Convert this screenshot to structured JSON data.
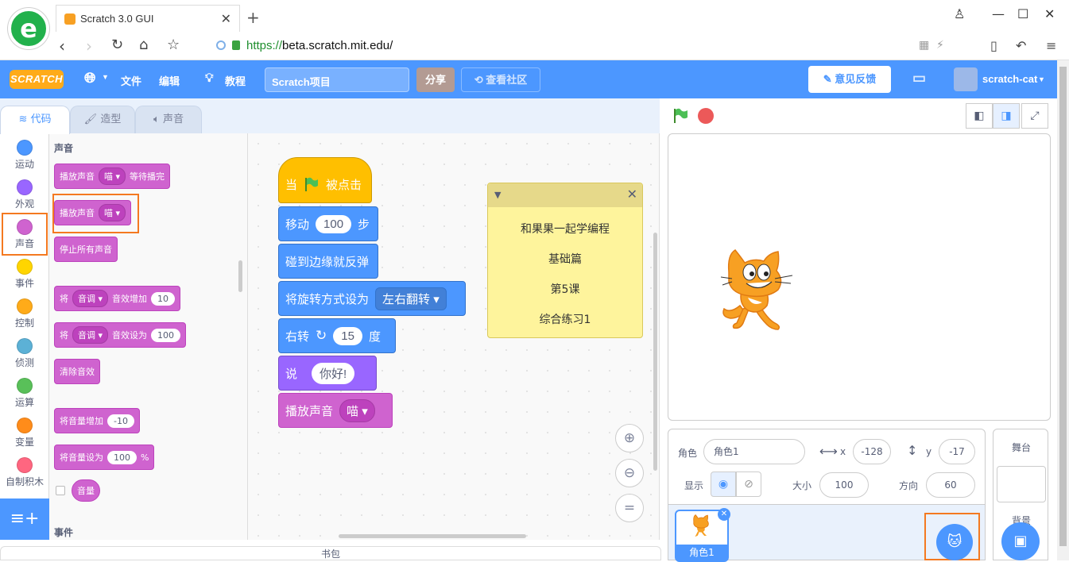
{
  "browser": {
    "tab_title": "Scratch 3.0 GUI",
    "url_scheme": "https://",
    "url_host": "beta.scratch.mit.edu/",
    "logo_letter": "e"
  },
  "menu": {
    "logo": "SCRATCH",
    "file": "文件",
    "edit": "编辑",
    "tutorials": "教程",
    "project_title": "Scratch项目",
    "share": "分享",
    "see_community": "查看社区",
    "feedback": "意见反馈",
    "username": "scratch-cat"
  },
  "editor_tabs": [
    {
      "label": "代码",
      "icon": "code-icon"
    },
    {
      "label": "造型",
      "icon": "brush-icon"
    },
    {
      "label": "声音",
      "icon": "speaker-icon"
    }
  ],
  "categories": [
    {
      "label": "运动",
      "color": "#4c97ff"
    },
    {
      "label": "外观",
      "color": "#9966ff"
    },
    {
      "label": "声音",
      "color": "#cf63cf"
    },
    {
      "label": "事件",
      "color": "#ffd500"
    },
    {
      "label": "控制",
      "color": "#ffab19"
    },
    {
      "label": "侦测",
      "color": "#5cb1d6"
    },
    {
      "label": "运算",
      "color": "#59c059"
    },
    {
      "label": "变量",
      "color": "#ff8c1a"
    },
    {
      "label": "自制积木",
      "color": "#ff6680"
    }
  ],
  "palette": {
    "heading_sound": "声音",
    "heading_events": "事件",
    "blocks": {
      "play_until_done": {
        "text": "播放声音",
        "dd": "喵",
        "suffix": "等待播完"
      },
      "start_sound": {
        "text": "播放声音",
        "dd": "喵"
      },
      "stop_all": {
        "text": "停止所有声音"
      },
      "change_effect": {
        "prefix": "将",
        "dd": "音调",
        "text": "音效增加",
        "value": "10"
      },
      "set_effect": {
        "prefix": "将",
        "dd": "音调",
        "text": "音效设为",
        "value": "100"
      },
      "clear_effects": {
        "text": "清除音效"
      },
      "change_volume": {
        "text": "将音量增加",
        "value": "-10"
      },
      "set_volume": {
        "text": "将音量设为",
        "value": "100",
        "suffix": "%"
      },
      "volume_reporter": {
        "text": "音量"
      }
    }
  },
  "script": {
    "when_flag": {
      "prefix": "当",
      "suffix": "被点击"
    },
    "move": {
      "text": "移动",
      "value": "100",
      "suffix": "步"
    },
    "bounce": {
      "text": "碰到边缘就反弹"
    },
    "rotation_style": {
      "text": "将旋转方式设为",
      "dd": "左右翻转"
    },
    "turn": {
      "text": "右转",
      "value": "15",
      "suffix": "度"
    },
    "say": {
      "text": "说",
      "value": "你好!"
    },
    "play_sound": {
      "text": "播放声音",
      "dd": "喵"
    }
  },
  "note": {
    "lines": [
      "和果果一起学编程",
      "基础篇",
      "第5课",
      "综合练习1"
    ]
  },
  "backpack": "书包",
  "sprite_info": {
    "sprite_label": "角色",
    "sprite_name": "角色1",
    "x_label": "x",
    "x": "-128",
    "y_label": "y",
    "y": "-17",
    "show_label": "显示",
    "size_label": "大小",
    "size": "100",
    "direction_label": "方向",
    "direction": "60"
  },
  "sprite_list": {
    "thumb_label": "角色1"
  },
  "stage_selector": {
    "title": "舞台",
    "backdrop_label": "背景"
  },
  "colors": {
    "menu_bar": "#4c97ff",
    "highlight": "#f47920"
  }
}
